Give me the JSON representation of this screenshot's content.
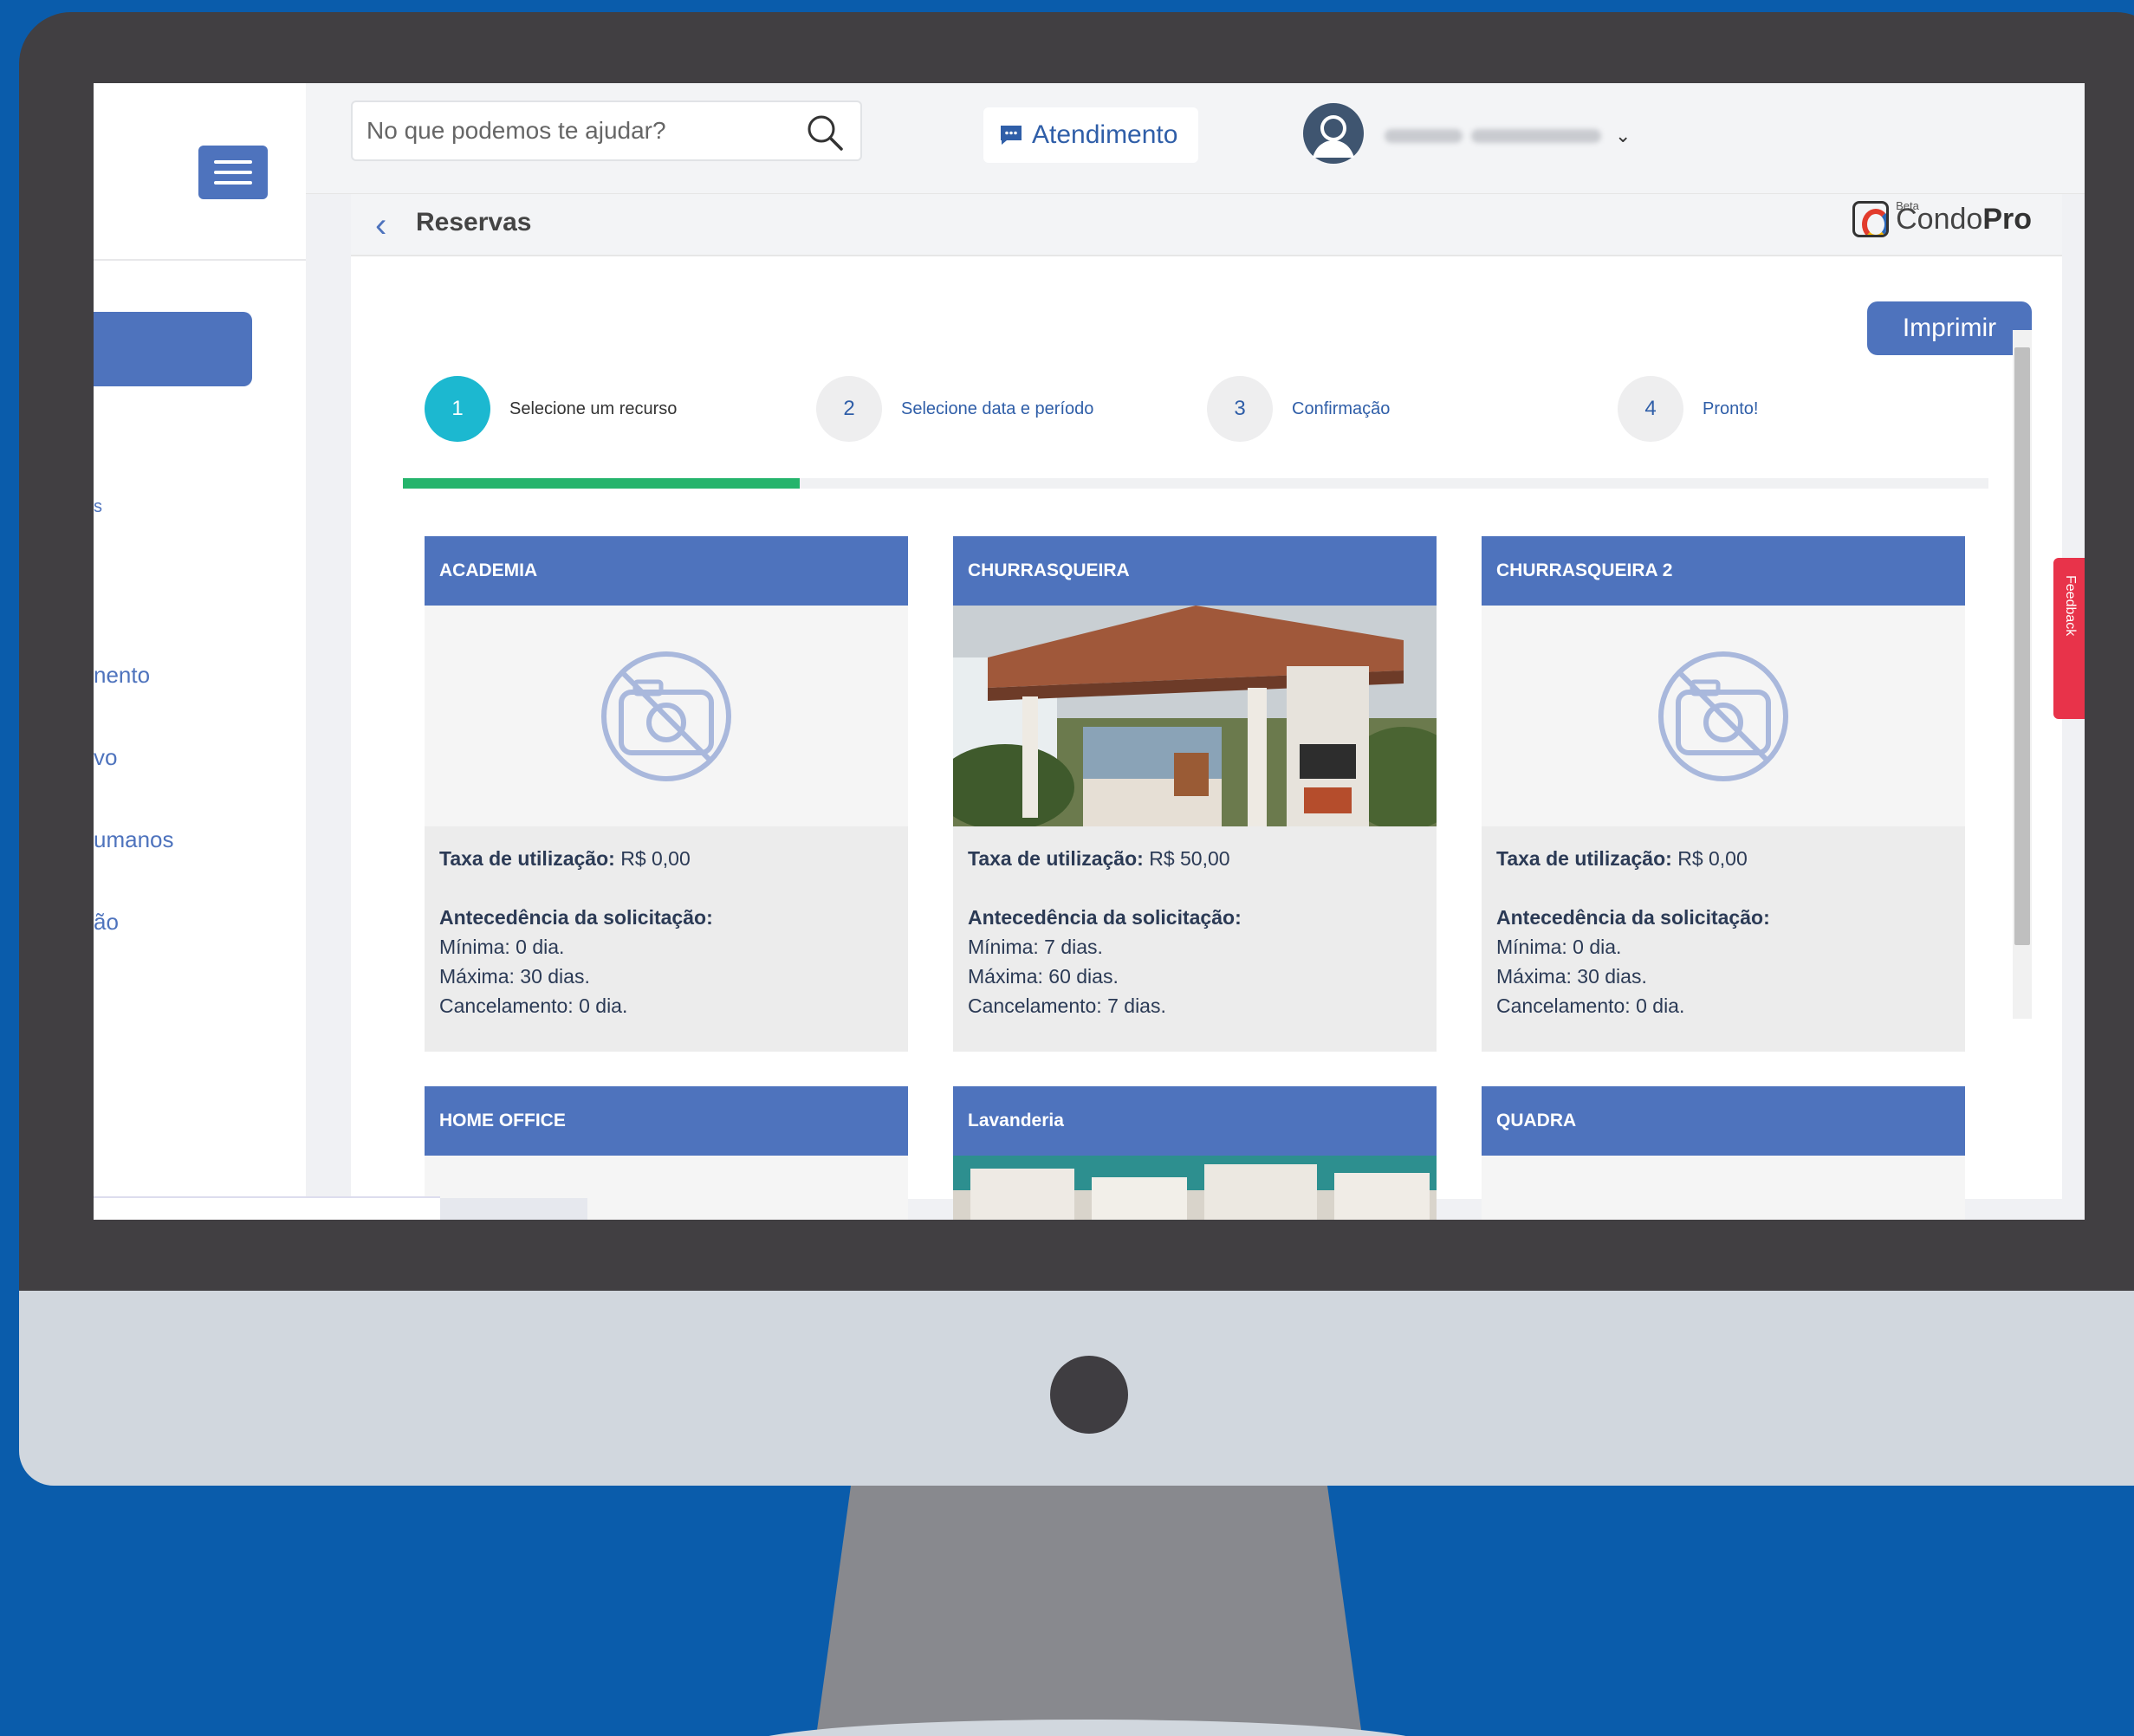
{
  "search": {
    "placeholder": "No que podemos te ajudar?"
  },
  "topbar": {
    "atendimento_label": "Atendimento"
  },
  "sidebar": {
    "items": [
      "s",
      "nento",
      "vo",
      "umanos",
      "ão"
    ]
  },
  "page": {
    "title": "Reservas",
    "print_label": "Imprimir"
  },
  "logo": {
    "beta": "Beta",
    "name_light": "Condo",
    "name_bold": "Pro"
  },
  "steps": [
    {
      "number": "1",
      "label": "Selecione um recurso",
      "active": true
    },
    {
      "number": "2",
      "label": "Selecione data e período",
      "active": false
    },
    {
      "number": "3",
      "label": "Confirmação",
      "active": false
    },
    {
      "number": "4",
      "label": "Pronto!",
      "active": false
    }
  ],
  "progress_fraction": 0.25,
  "cards": [
    {
      "name": "ACADEMIA",
      "image": "no-image",
      "fee_label": "Taxa de utilização:",
      "fee": "R$ 0,00",
      "lead_label": "Antecedência da solicitação:",
      "min": "Mínima: 0 dia.",
      "max": "Máxima: 30 dias.",
      "cancel": "Cancelamento: 0 dia."
    },
    {
      "name": "CHURRASQUEIRA",
      "image": "barbecue-photo",
      "fee_label": "Taxa de utilização:",
      "fee": "R$ 50,00",
      "lead_label": "Antecedência da solicitação:",
      "min": "Mínima: 7 dias.",
      "max": "Máxima: 60 dias.",
      "cancel": "Cancelamento: 7 dias."
    },
    {
      "name": "CHURRASQUEIRA 2",
      "image": "no-image",
      "fee_label": "Taxa de utilização:",
      "fee": "R$ 0,00",
      "lead_label": "Antecedência da solicitação:",
      "min": "Mínima: 0 dia.",
      "max": "Máxima: 30 dias.",
      "cancel": "Cancelamento: 0 dia."
    },
    {
      "name": "HOME OFFICE",
      "image": "no-image"
    },
    {
      "name": "Lavanderia",
      "image": "laundry-photo"
    },
    {
      "name": "QUADRA",
      "image": "no-image"
    }
  ],
  "feedback_label": "Feedback",
  "colors": {
    "primary": "#4e73bd",
    "step_active": "#1cb8d0",
    "progress": "#25b46c",
    "background": "#0a5cab"
  }
}
